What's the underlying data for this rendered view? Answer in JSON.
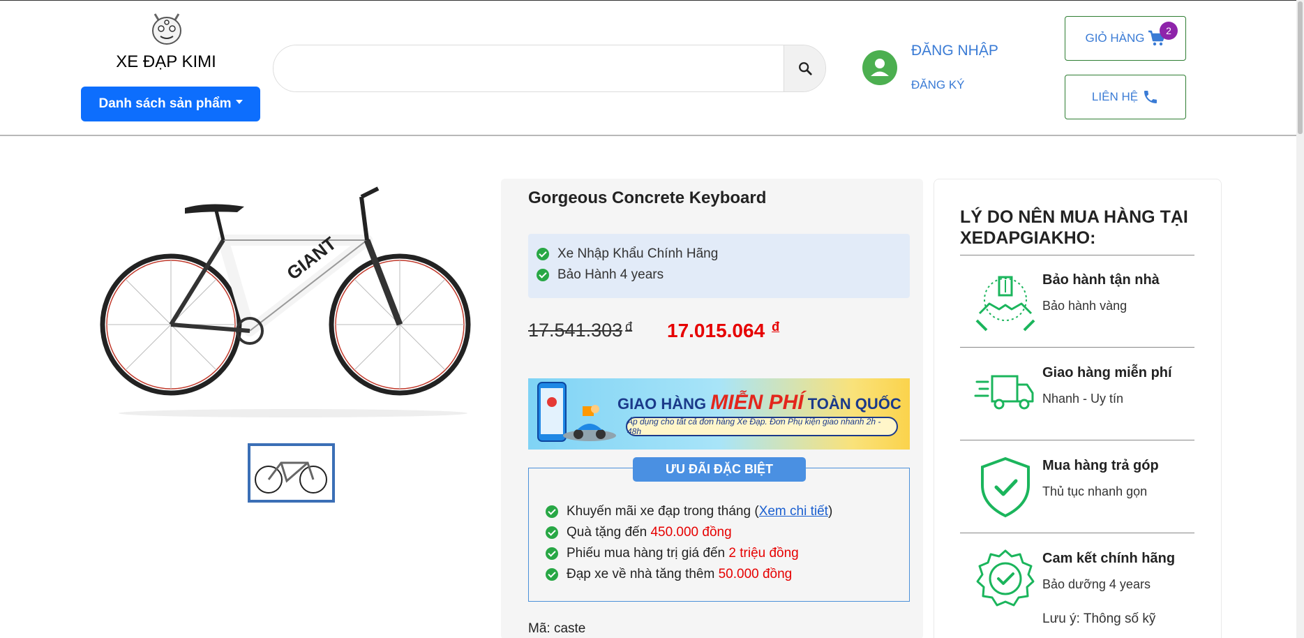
{
  "header": {
    "brand": "XE ĐẠP KIMI",
    "category_button": "Danh sách sản phẩm",
    "search_placeholder": "",
    "login": "ĐĂNG NHẬP",
    "register": "ĐĂNG KÝ",
    "cart_label": "GIỎ HÀNG",
    "cart_count": "2",
    "contact_label": "LIÊN HỆ"
  },
  "product": {
    "title": "Gorgeous Concrete Keyboard",
    "features": [
      "Xe Nhập Khẩu Chính Hãng",
      "Bảo Hành 4 years"
    ],
    "old_price": "17.541.303",
    "new_price": "17.015.064",
    "currency": "đ",
    "sku": "Mã: caste"
  },
  "banner": {
    "text_before": "GIAO HÀNG",
    "text_highlight": "MIỄN PHÍ",
    "text_after": "TOÀN QUỐC",
    "subtitle": "Áp dụng cho tất cả đơn hàng Xe Đạp. Đơn Phụ kiện giao nhanh 2h - 48h"
  },
  "promo": {
    "heading": "ƯU ĐÃI ĐẶC BIỆT",
    "items": [
      {
        "text": "Khuyến mãi xe đạp trong tháng (",
        "link": "Xem chi tiết",
        "after": ")"
      },
      {
        "text": "Quà tặng đến ",
        "highlight": "450.000 đồng"
      },
      {
        "text": "Phiếu mua hàng trị giá đến ",
        "highlight": "2 triệu đồng"
      },
      {
        "text": "Đạp xe về nhà tăng thêm ",
        "highlight": "50.000 đồng"
      }
    ]
  },
  "reasons": {
    "title": "LÝ DO NÊN MUA HÀNG TẠI XEDAPGIAKHO:",
    "items": [
      {
        "title": "Bảo hành tận nhà",
        "sub": "Bảo hành vàng",
        "icon": "hands-care-icon"
      },
      {
        "title": "Giao hàng miễn phí",
        "sub": "Nhanh - Uy tín",
        "icon": "delivery-truck-icon"
      },
      {
        "title": "Mua hàng trả góp",
        "sub": "Thủ tục nhanh gọn",
        "icon": "shield-check-icon"
      },
      {
        "title": "Cam kết chính hãng",
        "sub": "Bảo dưỡng 4 years",
        "icon": "badge-check-icon"
      }
    ],
    "note": "Lưu ý: Thông số kỹ"
  },
  "colors": {
    "primary": "#0d6efd",
    "link": "#3a7bd5",
    "price": "#e60000",
    "green": "#28a745",
    "accent_green": "#1bb55c"
  }
}
